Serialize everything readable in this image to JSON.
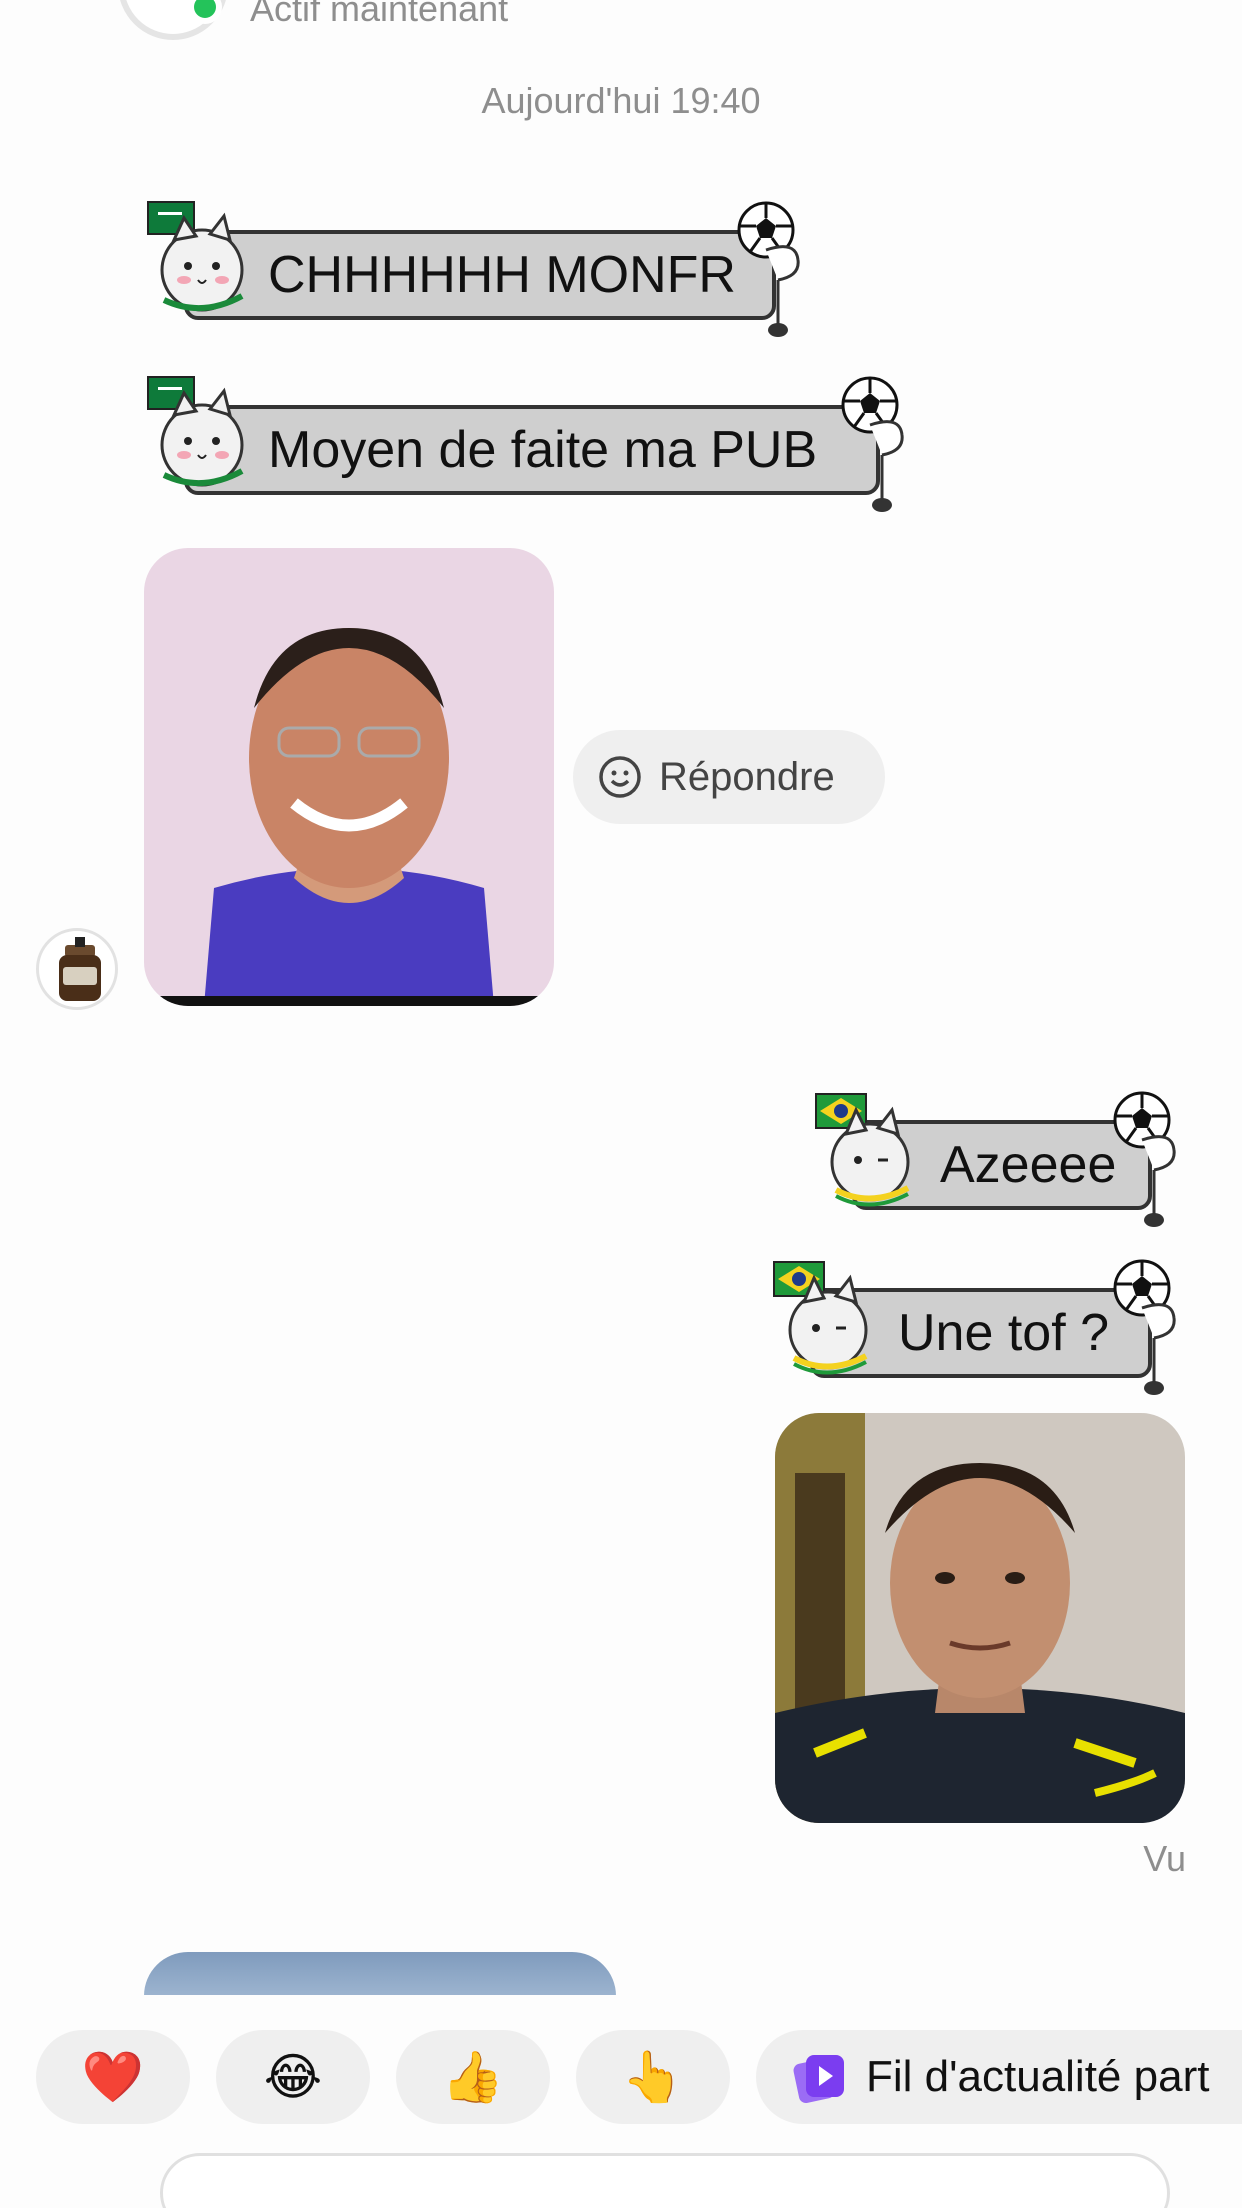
{
  "header": {
    "status": "Actif maintenant"
  },
  "timestamp": "Aujourd'hui 19:40",
  "messages": {
    "in1": "CHHHHHH MONFR",
    "in2": "Moyen de faite ma PUB",
    "reply_label": "Répondre",
    "out1": "Azeeee",
    "out2": "Une tof ?",
    "seen": "Vu"
  },
  "quick_reactions": {
    "heart": "❤️",
    "laugh": "😂",
    "thumbs": "👍",
    "point": "👆",
    "feed_label": "Fil d'actualité part"
  },
  "colors": {
    "online": "#24c35a",
    "bubble": "#cfcfcf",
    "chip": "#efefef",
    "feed_icon": "#7b3df0"
  }
}
